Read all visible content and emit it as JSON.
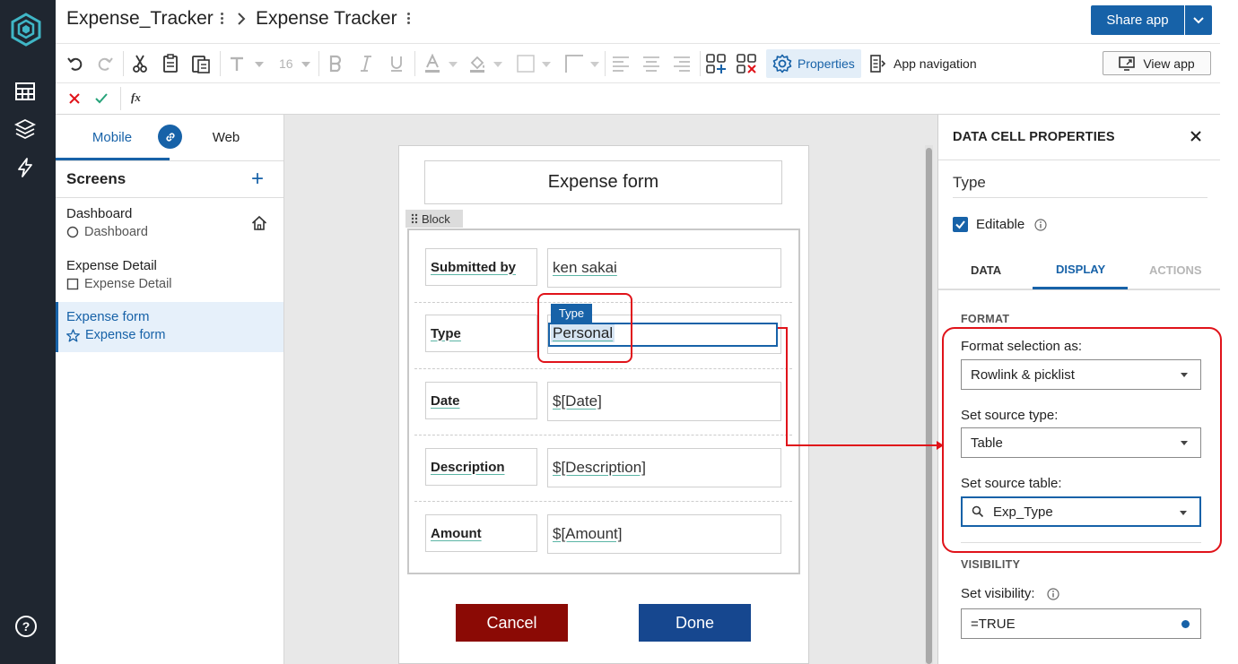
{
  "breadcrumb": {
    "workbook": "Expense_Tracker",
    "app": "Expense Tracker"
  },
  "share": {
    "label": "Share app"
  },
  "toolbar": {
    "font_size": "16",
    "properties_label": "Properties",
    "app_navigation_label": "App navigation",
    "view_app_label": "View app"
  },
  "formula_bar": {
    "fx_label": "fx"
  },
  "left_panel": {
    "tabs": [
      {
        "label": "Mobile"
      },
      {
        "label": "Web"
      }
    ],
    "screens_title": "Screens",
    "add_symbol": "+",
    "screens": [
      {
        "name": "Dashboard",
        "sub": "Dashboard",
        "icon": "circle-icon"
      },
      {
        "name": "Expense Detail",
        "sub": "Expense Detail",
        "icon": "square-icon"
      },
      {
        "name": "Expense form",
        "sub": "Expense form",
        "icon": "star-icon",
        "selected": true
      }
    ]
  },
  "canvas": {
    "form_title": "Expense form",
    "block_label": "Block",
    "tooltip": "Type",
    "rows": [
      {
        "label": "Submitted by",
        "value": "ken sakai"
      },
      {
        "label": "Type",
        "value": "Personal"
      },
      {
        "label": "Date",
        "value": "$[Date]"
      },
      {
        "label": "Description",
        "value": "$[Description]"
      },
      {
        "label": "Amount",
        "value": "$[Amount]"
      }
    ],
    "cancel_label": "Cancel",
    "done_label": "Done"
  },
  "right_panel": {
    "title": "DATA CELL PROPERTIES",
    "cell_name": "Type",
    "editable_label": "Editable",
    "editable_checked": true,
    "tabs": [
      {
        "label": "DATA"
      },
      {
        "label": "DISPLAY",
        "active": true
      },
      {
        "label": "ACTIONS",
        "disabled": true
      }
    ],
    "format_section": "FORMAT",
    "format_selection_label": "Format selection as:",
    "format_selection_value": "Rowlink & picklist",
    "source_type_label": "Set source type:",
    "source_type_value": "Table",
    "source_table_label": "Set source table:",
    "source_table_value": "Exp_Type",
    "visibility_section": "VISIBILITY",
    "visibility_label": "Set visibility:",
    "visibility_value": "=TRUE"
  },
  "colors": {
    "accent": "#1762a8",
    "rail": "#1f2630",
    "annotation": "#e0131a",
    "cancel": "#8b0a05",
    "done": "#16478f"
  }
}
